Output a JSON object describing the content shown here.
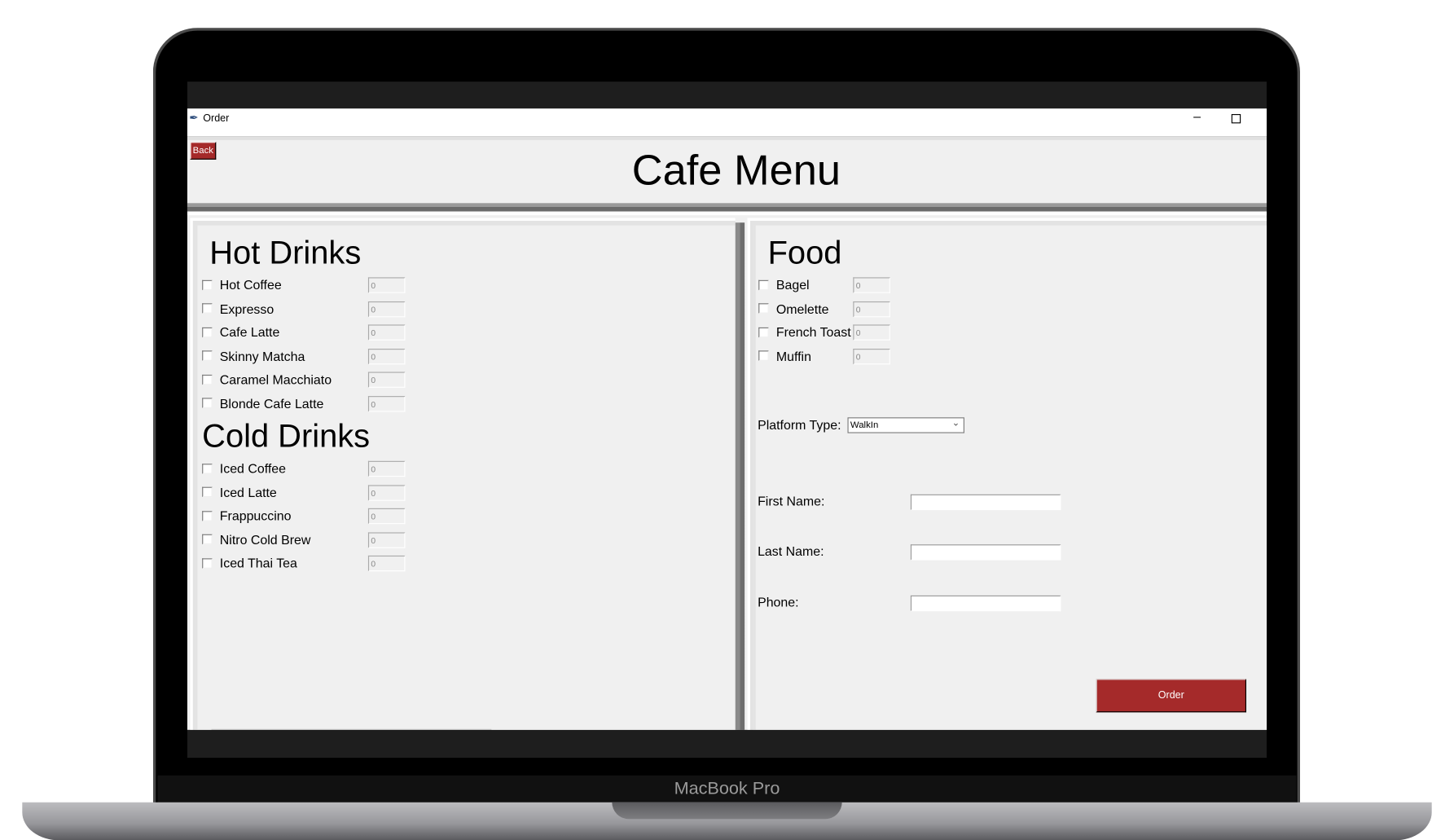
{
  "device": {
    "brand_label": "MacBook Pro"
  },
  "window": {
    "title": "Order",
    "minimize_glyph": "–"
  },
  "header": {
    "back_label": "Back",
    "title": "Cafe Menu"
  },
  "hot_drinks": {
    "heading": "Hot Drinks",
    "items": [
      {
        "label": "Hot Coffee",
        "qty": "0",
        "checked": false
      },
      {
        "label": "Expresso",
        "qty": "0",
        "checked": false
      },
      {
        "label": "Cafe Latte",
        "qty": "0",
        "checked": false
      },
      {
        "label": "Skinny Matcha",
        "qty": "0",
        "checked": false
      },
      {
        "label": "Caramel Macchiato",
        "qty": "0",
        "checked": false
      },
      {
        "label": "Blonde Cafe Latte",
        "qty": "0",
        "checked": false
      }
    ]
  },
  "cold_drinks": {
    "heading": "Cold Drinks",
    "items": [
      {
        "label": "Iced Coffee",
        "qty": "0",
        "checked": false
      },
      {
        "label": "Iced Latte",
        "qty": "0",
        "checked": false
      },
      {
        "label": "Frappuccino",
        "qty": "0",
        "checked": false
      },
      {
        "label": "Nitro Cold Brew",
        "qty": "0",
        "checked": false
      },
      {
        "label": "Iced Thai Tea",
        "qty": "0",
        "checked": false
      }
    ]
  },
  "food": {
    "heading": "Food",
    "items": [
      {
        "label": "Bagel",
        "qty": "0",
        "checked": false
      },
      {
        "label": "Omelette",
        "qty": "0",
        "checked": false
      },
      {
        "label": "French Toast",
        "qty": "0",
        "checked": false
      },
      {
        "label": "Muffin",
        "qty": "0",
        "checked": false
      }
    ]
  },
  "form": {
    "platform_label": "Platform Type:",
    "platform_value": "WalkIn",
    "first_name_label": "First Name:",
    "first_name_value": "",
    "last_name_label": "Last Name:",
    "last_name_value": "",
    "phone_label": "Phone:",
    "phone_value": "",
    "order_label": "Order"
  },
  "colors": {
    "accent": "#a52a2a",
    "window_bg": "#f0f0f0"
  }
}
